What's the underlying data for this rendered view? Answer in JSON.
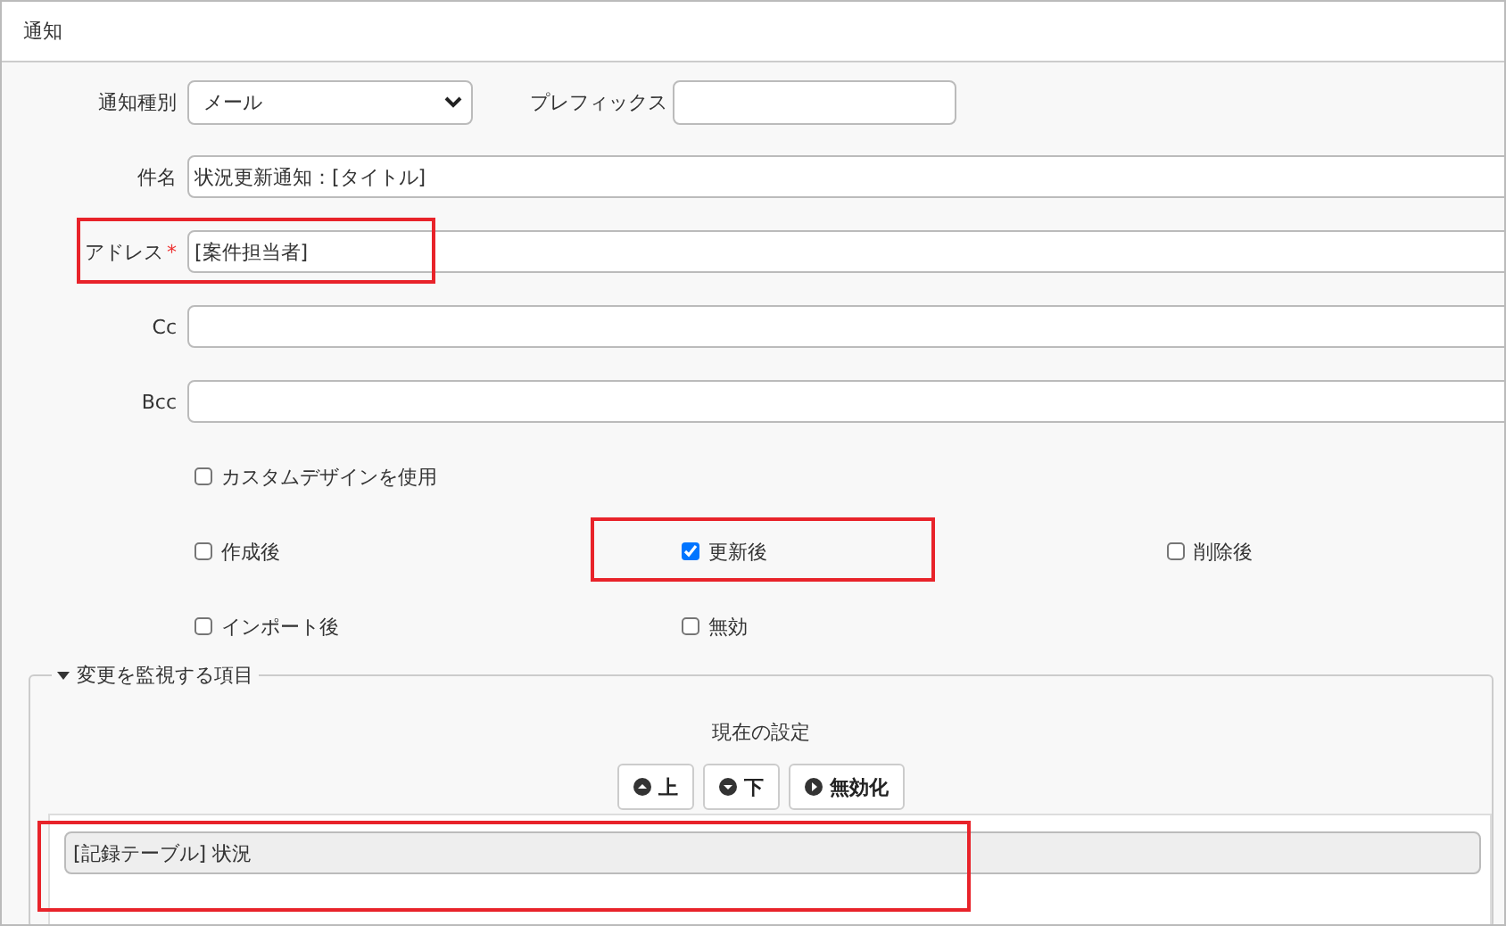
{
  "window": {
    "title": "通知"
  },
  "notification_type": {
    "label": "通知種別",
    "value": "メール"
  },
  "prefix": {
    "label": "プレフィックス"
  },
  "fields": [
    {
      "label": "件名",
      "value": "状況更新通知：[タイトル]"
    },
    {
      "label": "アドレス",
      "required_mark": "*",
      "value": "[案件担当者]"
    },
    {
      "label": "Cc"
    },
    {
      "label": "Bcc"
    }
  ],
  "custom_design": {
    "label": "カスタムデザインを使用",
    "checked": false
  },
  "triggers": [
    {
      "label": "作成後",
      "checked": false
    },
    {
      "label": "更新後",
      "checked": true
    },
    {
      "label": "削除後",
      "checked": false
    },
    {
      "label": "インポート後",
      "checked": false
    },
    {
      "label": "無効",
      "checked": false
    }
  ],
  "monitored": {
    "legend": "変更を監視する項目",
    "expanded": true,
    "heading": "現在の設定",
    "buttons": [
      {
        "label": "上",
        "kind": "up"
      },
      {
        "label": "下",
        "kind": "down"
      },
      {
        "label": "無効化",
        "kind": "disable"
      }
    ],
    "items": [
      {
        "label": "[記録テーブル] 状況"
      }
    ]
  }
}
